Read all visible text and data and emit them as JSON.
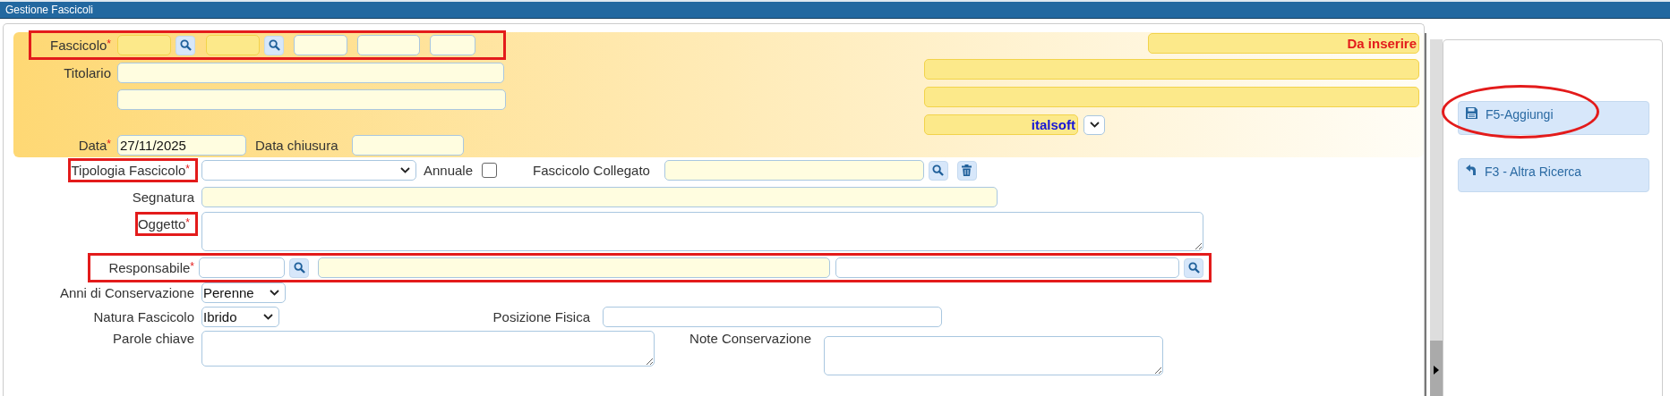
{
  "window": {
    "title": "Gestione Fascicoli"
  },
  "header": {
    "fascicolo": {
      "label": "Fascicolo",
      "required_mark": "*",
      "highlighted": true
    },
    "titolario": {
      "label": "Titolario"
    },
    "data": {
      "label": "Data",
      "required_mark": "*",
      "value": "27/11/2025"
    },
    "data_chiusura": {
      "label": "Data chiusura"
    },
    "status": {
      "value": "Da inserire"
    },
    "ufficio": {
      "value": "italsoft"
    }
  },
  "form": {
    "tipologia": {
      "label": "Tipologia Fascicolo",
      "required_mark": "*",
      "highlighted": true
    },
    "annuale": {
      "label": "Annuale",
      "checked": false
    },
    "collegato": {
      "label": "Fascicolo Collegato"
    },
    "segnatura": {
      "label": "Segnatura"
    },
    "oggetto": {
      "label": "Oggetto",
      "required_mark": "*",
      "highlighted": true
    },
    "responsabile": {
      "label": "Responsabile",
      "required_mark": "*",
      "highlighted": true
    },
    "anni": {
      "label": "Anni di Conservazione",
      "value": "Perenne"
    },
    "natura": {
      "label": "Natura Fascicolo",
      "value": "Ibrido"
    },
    "posizione": {
      "label": "Posizione Fisica"
    },
    "parole": {
      "label": "Parole chiave"
    },
    "note": {
      "label": "Note Conservazione"
    }
  },
  "actions": [
    {
      "label": "F5-Aggiungi",
      "kind": "save",
      "highlighted": true
    },
    {
      "label": "F3 - Altra Ricerca",
      "kind": "back",
      "highlighted": false
    }
  ]
}
